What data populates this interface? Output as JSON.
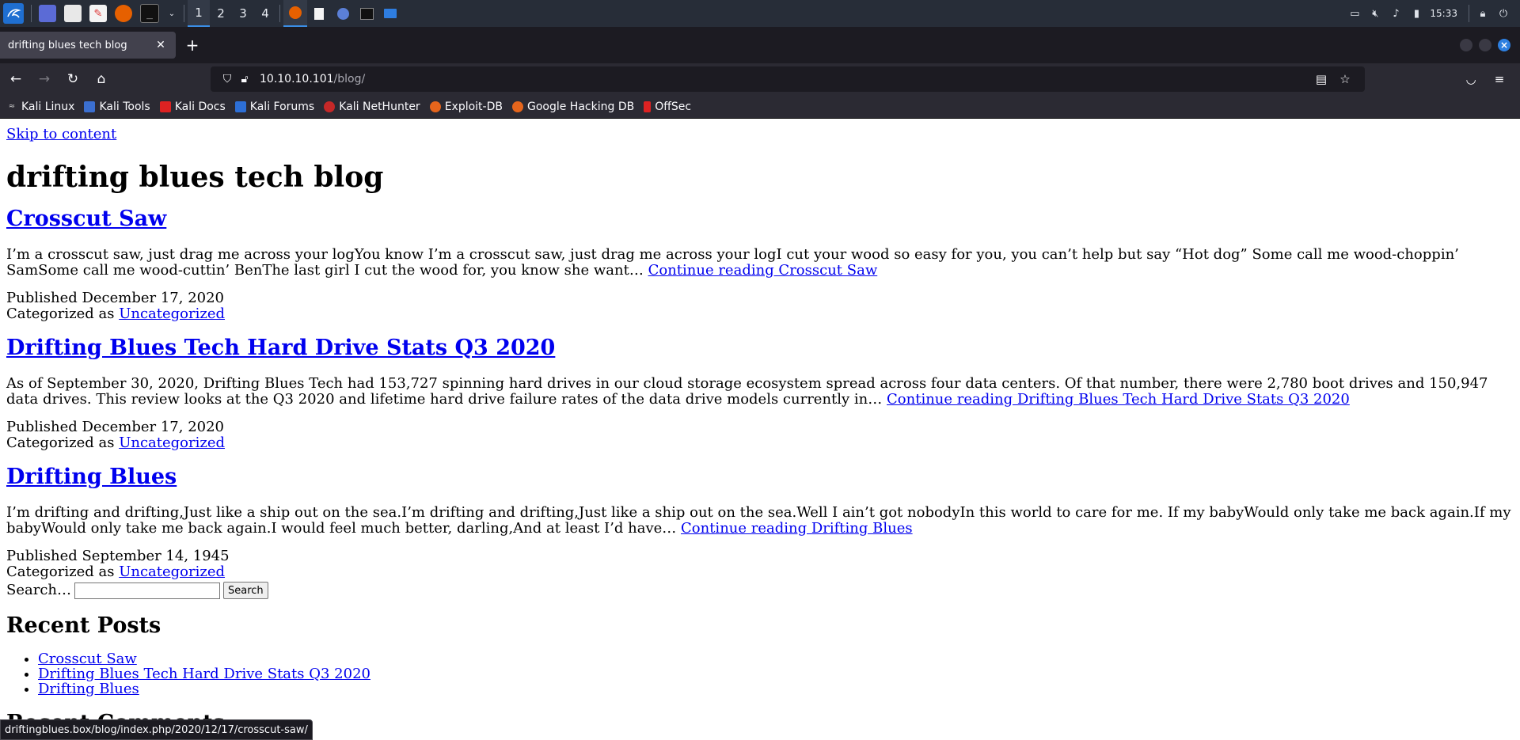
{
  "taskbar": {
    "workspaces": [
      "1",
      "2",
      "3",
      "4"
    ],
    "clock": "15:33"
  },
  "browser": {
    "tab_title": "drifting blues tech blog",
    "url_host": "10.10.10.101",
    "url_path": "/blog/",
    "bookmarks": [
      "Kali Linux",
      "Kali Tools",
      "Kali Docs",
      "Kali Forums",
      "Kali NetHunter",
      "Exploit-DB",
      "Google Hacking DB",
      "OffSec"
    ],
    "status_url": "driftingblues.box/blog/index.php/2020/12/17/crosscut-saw/"
  },
  "page": {
    "skip_link": "Skip to content",
    "site_title": "drifting blues tech blog",
    "posts": [
      {
        "title": "Crosscut Saw",
        "excerpt": "I’m a crosscut saw, just drag me across your logYou know I’m a crosscut saw, just drag me across your logI cut your wood so easy for you, you can’t help but say “Hot dog” Some call me wood-choppin’ SamSome call me wood-cuttin’ BenThe last girl I cut the wood for, you know she want… ",
        "continue": "Continue reading Crosscut Saw",
        "published": "Published December 17, 2020",
        "categorized_label": "Categorized as ",
        "category": "Uncategorized"
      },
      {
        "title": "Drifting Blues Tech Hard Drive Stats Q3 2020",
        "excerpt": "As of September 30, 2020, Drifting Blues Tech had 153,727 spinning hard drives in our cloud storage ecosystem spread across four data centers. Of that number, there were 2,780 boot drives and 150,947 data drives. This review looks at the Q3 2020 and lifetime hard drive failure rates of the data drive models currently in… ",
        "continue": "Continue reading Drifting Blues Tech Hard Drive Stats Q3 2020",
        "published": "Published December 17, 2020",
        "categorized_label": "Categorized as ",
        "category": "Uncategorized"
      },
      {
        "title": "Drifting Blues",
        "excerpt": "I’m drifting and drifting,Just like a ship out on the sea.I’m drifting and drifting,Just like a ship out on the sea.Well I ain’t got nobodyIn this world to care for me. If my babyWould only take me back again.If my babyWould only take me back again.I would feel much better, darling,And at least I’d have… ",
        "continue": "Continue reading Drifting Blues",
        "published": "Published September 14, 1945",
        "categorized_label": "Categorized as ",
        "category": "Uncategorized"
      }
    ],
    "search_label": "Search…",
    "search_button": "Search",
    "recent_posts_title": "Recent Posts",
    "recent_posts": [
      "Crosscut Saw",
      "Drifting Blues Tech Hard Drive Stats Q3 2020",
      "Drifting Blues"
    ],
    "recent_comments_title": "Recent Comments"
  }
}
